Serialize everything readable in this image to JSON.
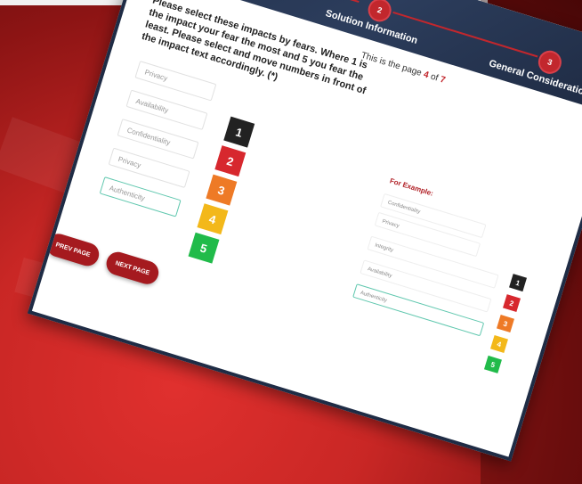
{
  "wizard": {
    "steps": [
      {
        "number": "",
        "label": "rmation"
      },
      {
        "number": "2",
        "label": "Solution Information"
      },
      {
        "number": "3",
        "label": "General Considerations"
      }
    ]
  },
  "page_indicator": {
    "prefix": "This is the page ",
    "current": "4",
    "sep": " of ",
    "total": "7"
  },
  "instructions": "Please select these impacts by fears. Where 1 is the impact your fear the most and 5 you fear the least. Please select and move numbers in front of the impact text accordingly. (*)",
  "impact_fields": [
    {
      "placeholder": "Privacy"
    },
    {
      "placeholder": "Availability"
    },
    {
      "placeholder": "Confidentiality"
    },
    {
      "placeholder": "Privacy"
    },
    {
      "placeholder": "Authenticity"
    }
  ],
  "rank_numbers": [
    "1",
    "2",
    "3",
    "4",
    "5"
  ],
  "example": {
    "title": "For Example:",
    "fields": [
      "Confidentiality",
      "Privacy",
      "Integrity",
      "Availability",
      "Authenticity"
    ],
    "numbers": [
      "1",
      "2",
      "3",
      "4",
      "5"
    ]
  },
  "buttons": {
    "prev": "PREV PAGE",
    "next": "NEXT PAGE"
  },
  "colors": {
    "accent": "#c2272d",
    "header": "#22304b",
    "rank_1": "#222222",
    "rank_2": "#d7282e",
    "rank_3": "#ee7a26",
    "rank_4": "#f3b81a",
    "rank_5": "#21bb4a"
  }
}
